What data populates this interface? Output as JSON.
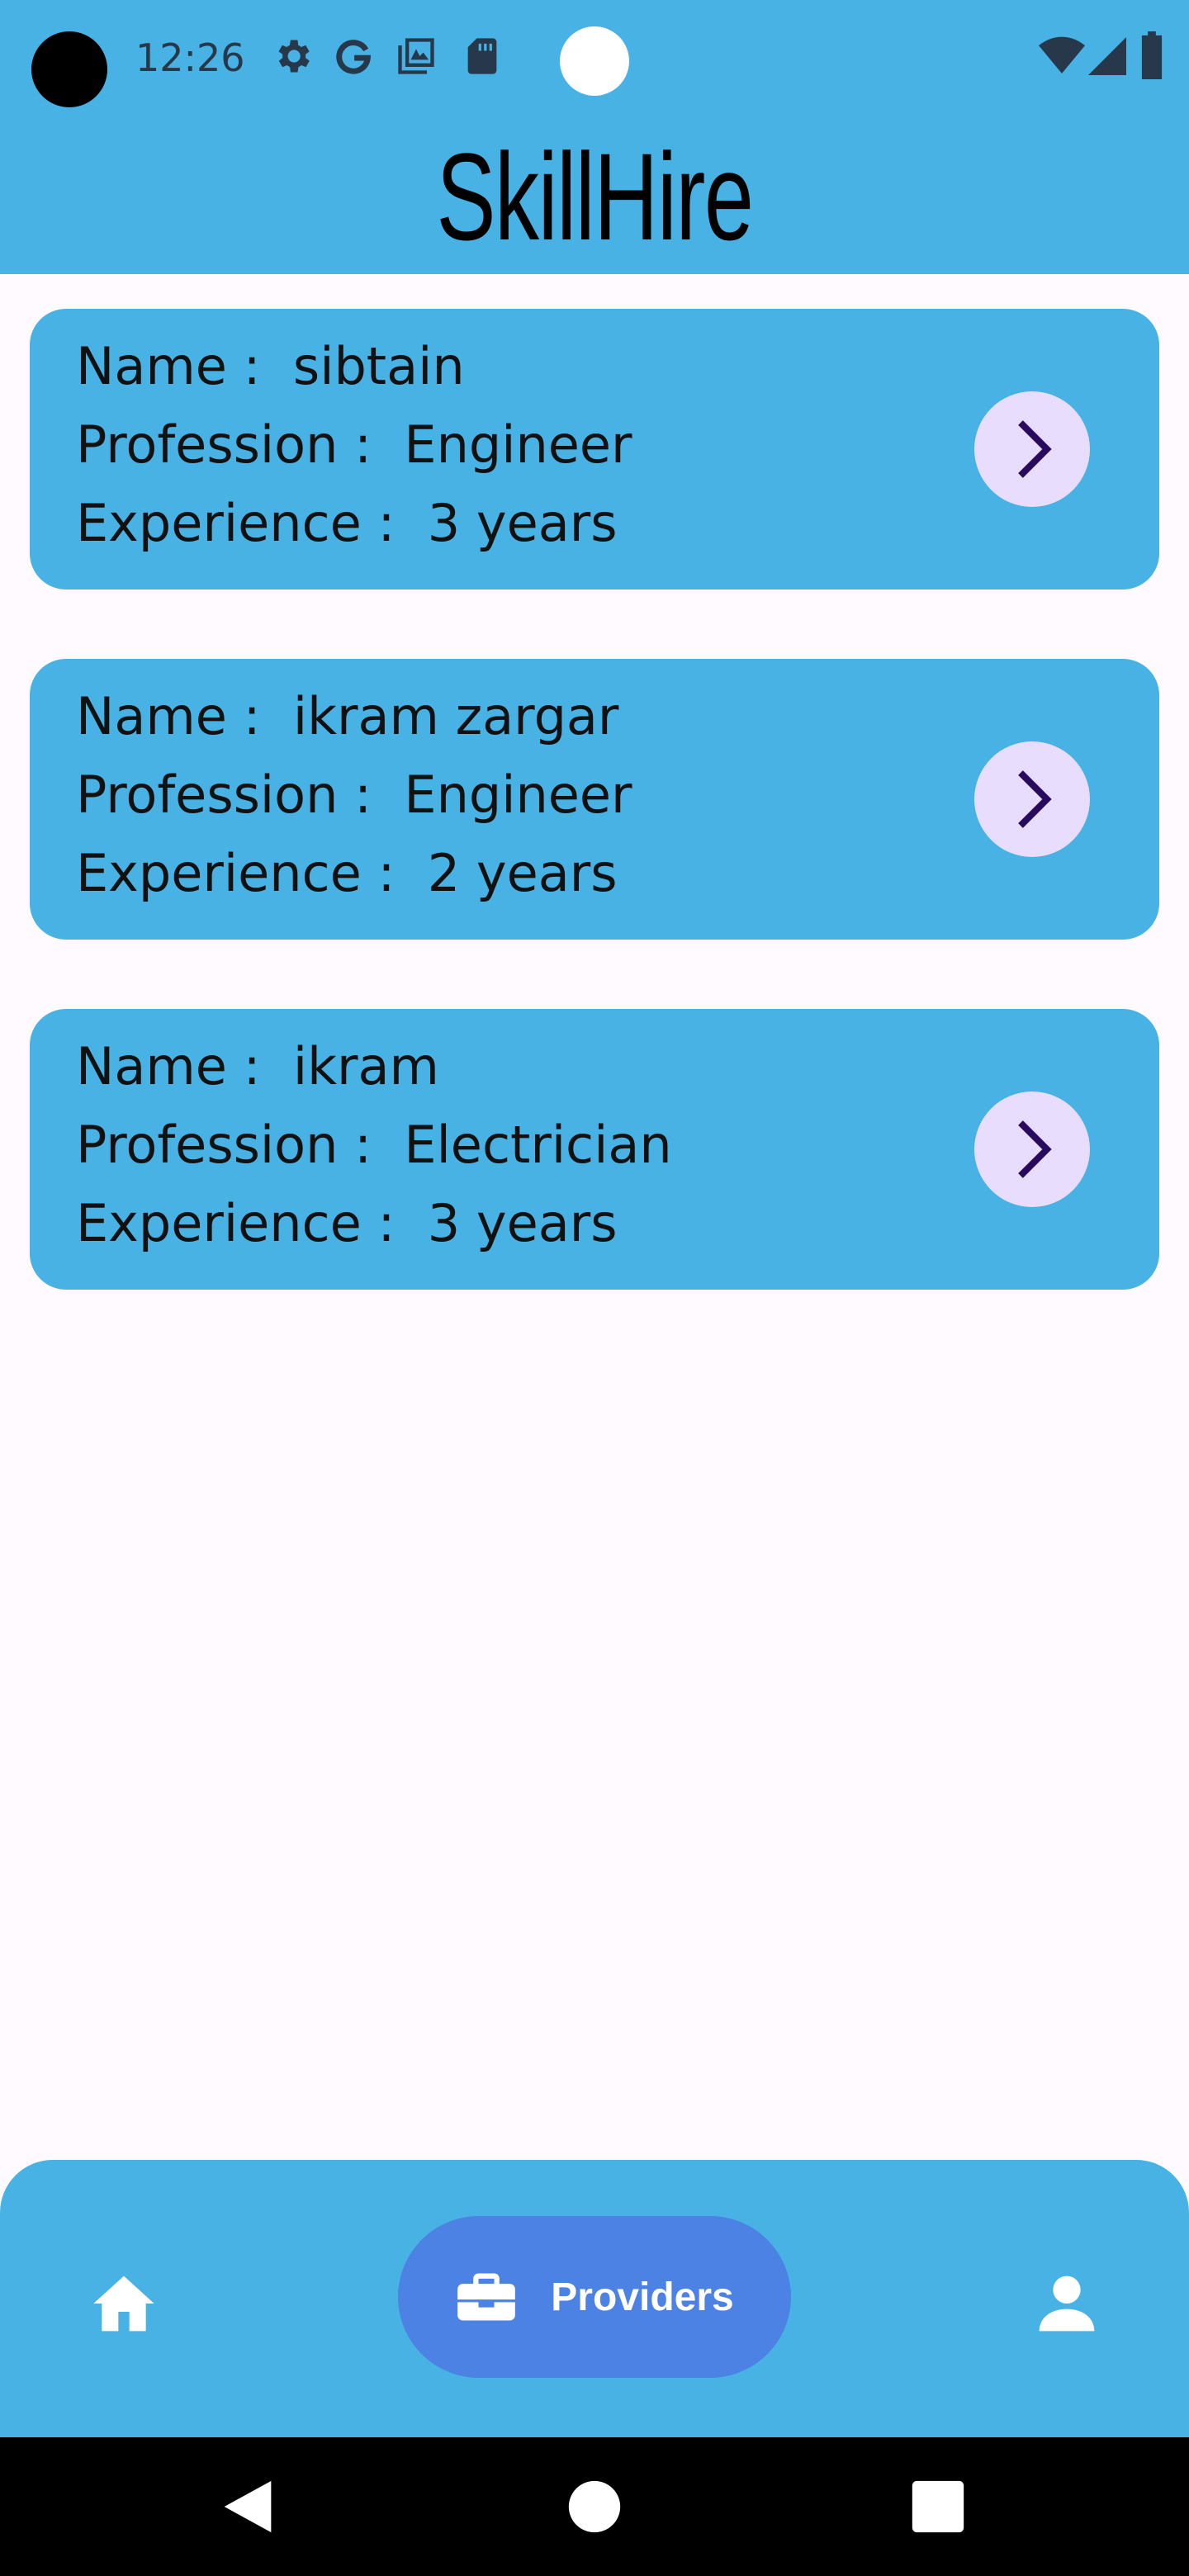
{
  "status_bar": {
    "time": "12:26",
    "left_icons": [
      "gear-icon",
      "google-icon",
      "gallery-icon",
      "sd-card-icon"
    ],
    "right_icons": [
      "wifi-icon",
      "signal-icon",
      "battery-icon"
    ]
  },
  "app": {
    "title": "SkillHire"
  },
  "providers": [
    {
      "name_line": "Name :  sibtain",
      "profession_line": "Profession :  Engineer",
      "experience_line": "Experience :  3 years"
    },
    {
      "name_line": "Name :  ikram zargar",
      "profession_line": "Profession :  Engineer",
      "experience_line": "Experience :  2 years"
    },
    {
      "name_line": "Name :  ikram",
      "profession_line": "Profession :  Electrician",
      "experience_line": "Experience :  3 years"
    }
  ],
  "bottom_nav": {
    "items": [
      {
        "icon": "home-icon",
        "label": ""
      },
      {
        "icon": "briefcase-icon",
        "label": "Providers",
        "selected": true
      },
      {
        "icon": "person-icon",
        "label": ""
      }
    ]
  },
  "system_nav": {
    "buttons": [
      "back-icon",
      "home-circle-icon",
      "recents-icon"
    ]
  },
  "colors": {
    "primary": "#48b2e4",
    "selected_pill": "#4b82e4",
    "arrow_button": "#e8ddfc",
    "arrow_glyph": "#2a0a5e",
    "background": "#fefaff"
  }
}
